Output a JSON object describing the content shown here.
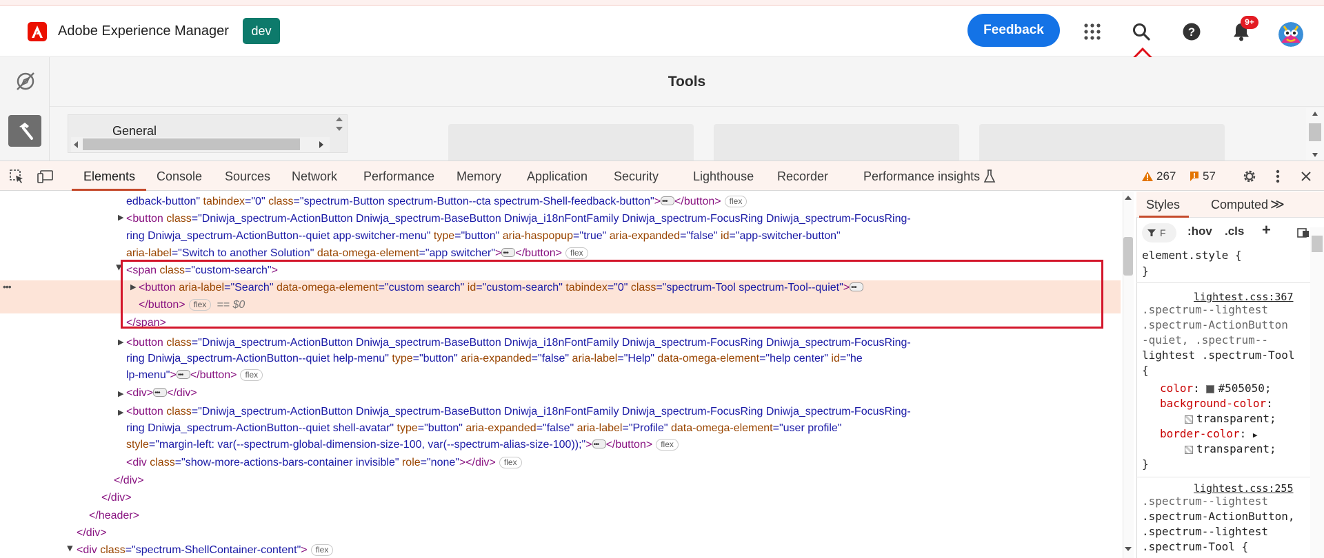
{
  "header": {
    "app_title": "Adobe Experience Manager",
    "env_badge": "dev",
    "feedback_label": "Feedback",
    "notification_count": "9+",
    "brand_color": "#1473e6",
    "icons": [
      "apps-grid-icon",
      "search-icon",
      "help-icon",
      "bell-icon",
      "avatar"
    ]
  },
  "page": {
    "title": "Tools",
    "general_label": "General"
  },
  "devtools": {
    "tabs": [
      "Elements",
      "Console",
      "Sources",
      "Network",
      "Performance",
      "Memory",
      "Application",
      "Security",
      "Lighthouse",
      "Recorder",
      "Performance insights"
    ],
    "active_tab": "Elements",
    "warnings": "267",
    "issues": "57"
  },
  "dom": {
    "l1": {
      "a": "edback-button\"",
      "b": " tabindex",
      "c": "=\"0\"",
      "d": " class",
      "e": "=\"spectrum-Button spectrum-Button--cta spectrum-Shell-feedback-button\"",
      "f": ">",
      "g": "</button>"
    },
    "l2": {
      "a": "<button",
      "b": " class",
      "c": "=\"Dniwja_spectrum-ActionButton Dniwja_spectrum-BaseButton Dniwja_i18nFontFamily Dniwja_spectrum-FocusRing Dniwja_spectrum-FocusRing-"
    },
    "l3": {
      "a": "ring Dniwja_spectrum-ActionButton--quiet app-switcher-menu\"",
      "b": " type",
      "c": "=\"button\"",
      "d": " aria-haspopup",
      "e": "=\"true\"",
      "f": " aria-expanded",
      "g": "=\"false\"",
      "h": " id",
      "i": "=\"app-switcher-button\""
    },
    "l4": {
      "a": "aria-label",
      "b": "=\"Switch to another Solution\"",
      "c": " data-omega-element",
      "d": "=\"app switcher\"",
      "e": ">",
      "f": "</button>"
    },
    "l5": {
      "a": "<span",
      "b": " class",
      "c": "=\"custom-search\"",
      "d": ">"
    },
    "l6": {
      "a": "<button",
      "b": " aria-label",
      "c": "=\"Search\"",
      "d": " data-omega-element",
      "e": "=\"custom search\"",
      "f": " id",
      "g": "=\"custom-search\"",
      "h": " tabindex",
      "i": "=\"0\"",
      "j": " class",
      "k": "=\"spectrum-Tool spectrum-Tool--quiet\"",
      "l": ">"
    },
    "l7": {
      "a": "</button>",
      "b": "== $0"
    },
    "l8": {
      "a": "</span>"
    },
    "l9": {
      "a": "<button",
      "b": " class",
      "c": "=\"Dniwja_spectrum-ActionButton Dniwja_spectrum-BaseButton Dniwja_i18nFontFamily Dniwja_spectrum-FocusRing Dniwja_spectrum-FocusRing-"
    },
    "l10": {
      "a": "ring Dniwja_spectrum-ActionButton--quiet help-menu\"",
      "b": " type",
      "c": "=\"button\"",
      "d": " aria-expanded",
      "e": "=\"false\"",
      "f": " aria-label",
      "g": "=\"Help\"",
      "h": " data-omega-element",
      "i": "=\"help center\"",
      "j": " id",
      "k": "=\"he"
    },
    "l11": {
      "a": "lp-menu\"",
      "b": ">",
      "c": "</button>"
    },
    "l12": {
      "a": "<div>",
      "b": "</div>"
    },
    "l13": {
      "a": "<button",
      "b": " class",
      "c": "=\"Dniwja_spectrum-ActionButton Dniwja_spectrum-BaseButton Dniwja_i18nFontFamily Dniwja_spectrum-FocusRing Dniwja_spectrum-FocusRing-"
    },
    "l14": {
      "a": "ring Dniwja_spectrum-ActionButton--quiet shell-avatar\"",
      "b": " type",
      "c": "=\"button\"",
      "d": " aria-expanded",
      "e": "=\"false\"",
      "f": " aria-label",
      "g": "=\"Profile\"",
      "h": " data-omega-element",
      "i": "=\"user profile\""
    },
    "l15": {
      "a": "style",
      "b": "=\"margin-left: var(--spectrum-global-dimension-size-100, var(--spectrum-alias-size-100));\"",
      "c": ">",
      "d": "</button>"
    },
    "l16": {
      "a": "<div",
      "b": " class",
      "c": "=\"show-more-actions-bars-container invisible\"",
      "d": " role",
      "e": "=\"none\"",
      "f": "></div>"
    },
    "l17": {
      "a": "</div>"
    },
    "l18": {
      "a": "</div>"
    },
    "l19": {
      "a": "</header>"
    },
    "l20": {
      "a": "</div>"
    },
    "l21": {
      "a": "<div",
      "b": " class",
      "c": "=\"spectrum-ShellContainer-content\"",
      "d": ">"
    },
    "flex_badge": "flex"
  },
  "styles": {
    "tabs": [
      "Styles",
      "Computed"
    ],
    "filter_placeholder": "F",
    "hov": ":hov",
    "cls": ".cls",
    "element_style": "element.style {",
    "close_brace": "}",
    "rule1": {
      "source": "lightest.css:367",
      "sel1": ".spectrum--lightest",
      "sel2": ".spectrum-ActionButton",
      "sel3": "-quiet, .spectrum--",
      "sel4": "lightest .spectrum-Tool",
      "sel5": "{",
      "p1": "color",
      "v1": "#505050;",
      "p2": "background-color",
      "v2": "transparent;",
      "p3": "border-color",
      "v3": "transparent;",
      "color_swatch": "#505050"
    },
    "rule2": {
      "source": "lightest.css:255",
      "sel1": ".spectrum--lightest",
      "sel2": ".spectrum-ActionButton,",
      "sel3": ".spectrum--lightest",
      "sel4": ".spectrum-Tool {"
    }
  }
}
